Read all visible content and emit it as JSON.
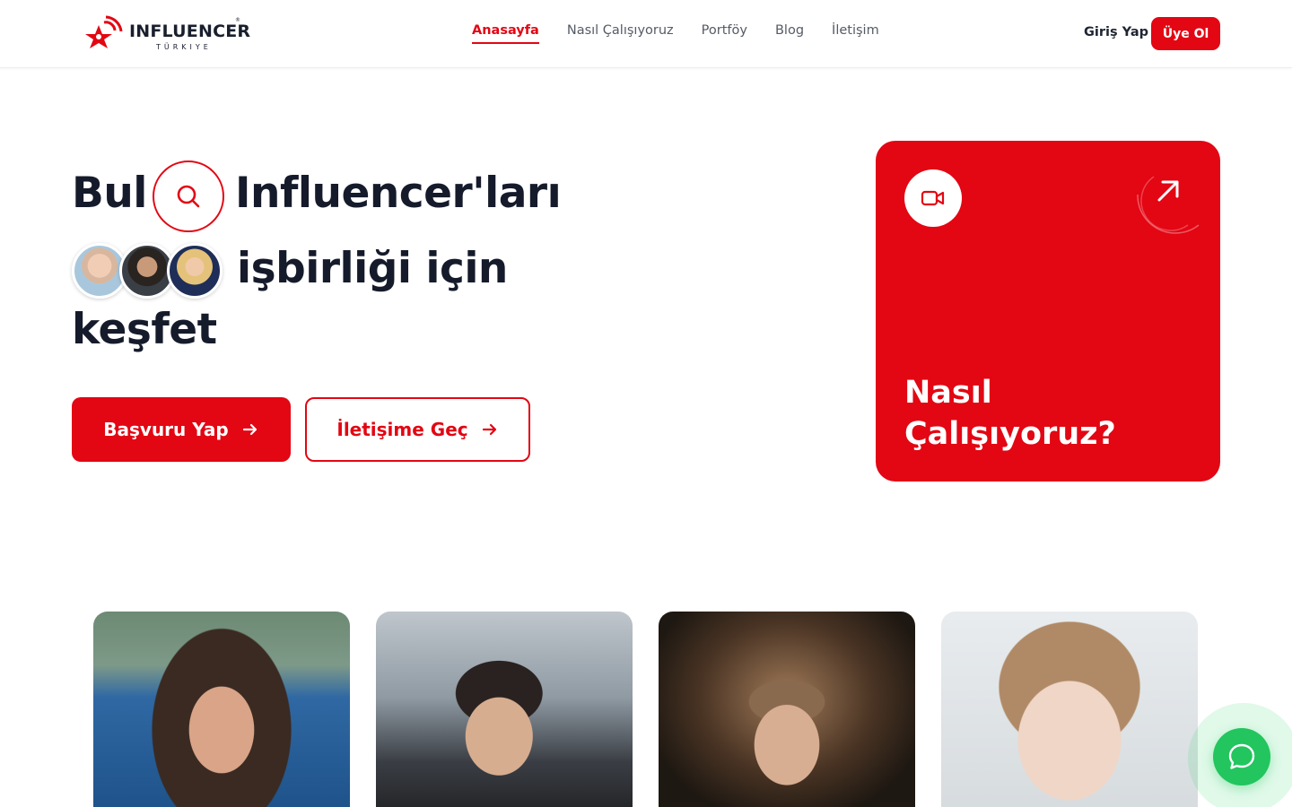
{
  "brand": {
    "name": "INFLUENCER",
    "sub": "TÜRKIYE",
    "accent": "#e30613"
  },
  "nav": {
    "items": [
      {
        "label": "Anasayfa",
        "active": true
      },
      {
        "label": "Nasıl Çalışıyoruz",
        "active": false
      },
      {
        "label": "Portföy",
        "active": false
      },
      {
        "label": "Blog",
        "active": false
      },
      {
        "label": "İletişim",
        "active": false
      }
    ],
    "login": "Giriş Yap",
    "signup": "Üye Ol"
  },
  "hero": {
    "word1": "Bul",
    "word2": "Influencer'ları",
    "line2": "işbirliği için",
    "line3": "keşfet",
    "primary_button": "Başvuru Yap",
    "secondary_button": "İletişime Geç",
    "search_icon": "search-icon",
    "avatar_count": 3
  },
  "card": {
    "title": "Nasıl Çalışıyoruz?",
    "icon": "video-camera-icon",
    "corner_icon": "arrow-up-right-icon",
    "color": "#e30613"
  },
  "gallery": {
    "photos": [
      "influencer-photo-1",
      "influencer-photo-2",
      "influencer-photo-3",
      "influencer-photo-4"
    ]
  },
  "chat": {
    "icon": "chat-bubble-icon",
    "color": "#22c55e"
  }
}
